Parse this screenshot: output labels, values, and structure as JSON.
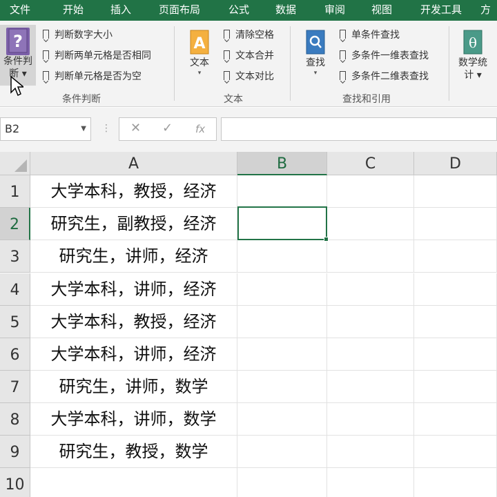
{
  "ribbon_tabs": [
    "文件",
    "开始",
    "插入",
    "页面布局",
    "公式",
    "数据",
    "审阅",
    "视图",
    "开发工具",
    "方"
  ],
  "groups": {
    "condition": {
      "big_button": {
        "label_line1": "条件判",
        "label_line2": "断",
        "icon": "question-book-icon"
      },
      "items": [
        "判断数字大小",
        "判断两单元格是否相同",
        "判断单元格是否为空"
      ],
      "label": "条件判断"
    },
    "text": {
      "big_button": {
        "label": "文本",
        "icon": "letter-a-book-icon"
      },
      "items": [
        "清除空格",
        "文本合并",
        "文本对比"
      ],
      "label": "文本"
    },
    "lookup": {
      "big_button": {
        "label": "查找",
        "icon": "magnifier-book-icon"
      },
      "items": [
        "单条件查找",
        "多条件一维表查找",
        "多条件二维表查找"
      ],
      "label": "查找和引用"
    },
    "stats": {
      "big_button": {
        "label_line1": "数学统",
        "label_line2": "计",
        "icon": "theta-book-icon"
      }
    }
  },
  "formula_bar": {
    "name_box": "B2",
    "cancel_icon": "✕",
    "enter_icon": "✓",
    "fx_icon": "fx",
    "formula": ""
  },
  "columns": [
    "A",
    "B",
    "C",
    "D"
  ],
  "selected_column": "B",
  "rows": [
    {
      "num": "1",
      "a": "大学本科，教授，经济"
    },
    {
      "num": "2",
      "a": "研究生，副教授，经济"
    },
    {
      "num": "3",
      "a": "研究生，讲师，经济"
    },
    {
      "num": "4",
      "a": "大学本科，讲师，经济"
    },
    {
      "num": "5",
      "a": "大学本科，教授，经济"
    },
    {
      "num": "6",
      "a": "大学本科，讲师，经济"
    },
    {
      "num": "7",
      "a": "研究生，讲师，数学"
    },
    {
      "num": "8",
      "a": "大学本科，讲师，数学"
    },
    {
      "num": "9",
      "a": "研究生，教授，数学"
    },
    {
      "num": "10",
      "a": ""
    }
  ],
  "active_cell": "B2",
  "colors": {
    "accent": "#217346",
    "icon_purple": "#7b5fa8",
    "icon_orange": "#f0a030",
    "icon_blue": "#2f6fae",
    "icon_teal": "#3e8c7c"
  }
}
